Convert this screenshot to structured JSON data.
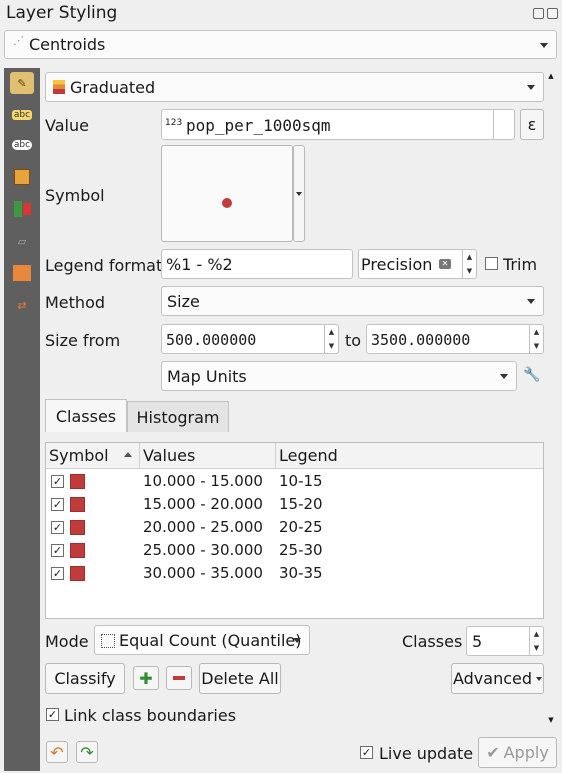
{
  "window": {
    "title": "Layer Styling"
  },
  "layer_selector": {
    "value": "Centroids"
  },
  "renderer": {
    "value": "Graduated"
  },
  "value": {
    "label": "Value",
    "prefix": "123",
    "field": "pop_per_1000sqm",
    "expr_symbol": "ε"
  },
  "symbol": {
    "label": "Symbol",
    "color": "#c23b3b"
  },
  "legend_format": {
    "label": "Legend format",
    "value": "%1 - %2",
    "precision_label": "Precision",
    "trim_label": "Trim"
  },
  "method": {
    "label": "Method",
    "value": "Size"
  },
  "size_from": {
    "label": "Size from",
    "from": "500.000000",
    "to_label": "to",
    "to": "3500.000000"
  },
  "unit": {
    "value": "Map Units"
  },
  "tabs": [
    {
      "label": "Classes"
    },
    {
      "label": "Histogram"
    }
  ],
  "table": {
    "headers": {
      "symbol": "Symbol",
      "values": "Values",
      "legend": "Legend"
    },
    "rows": [
      {
        "values": "10.000 - 15.000",
        "legend": "10-15"
      },
      {
        "values": "15.000 - 20.000",
        "legend": "15-20"
      },
      {
        "values": "20.000 - 25.000",
        "legend": "20-25"
      },
      {
        "values": "25.000 - 30.000",
        "legend": "25-30"
      },
      {
        "values": "30.000 - 35.000",
        "legend": "30-35"
      }
    ]
  },
  "mode": {
    "label": "Mode",
    "value": "Equal Count (Quantile)"
  },
  "classes": {
    "label": "Classes",
    "value": "5"
  },
  "buttons": {
    "classify": "Classify",
    "delete_all": "Delete All",
    "advanced": "Advanced",
    "apply": "Apply"
  },
  "link_boundaries": {
    "label": "Link class boundaries"
  },
  "live_update": {
    "label": "Live update"
  },
  "colors": {
    "accent": "#c23b3b",
    "sidebar": "#5f5f5f"
  }
}
